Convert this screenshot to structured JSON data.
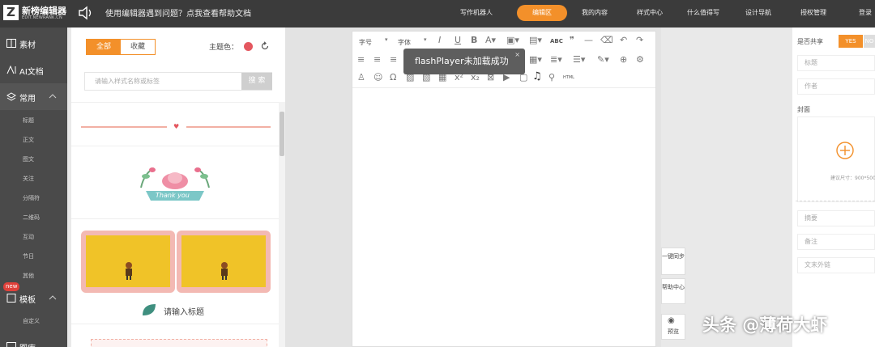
{
  "topbar": {
    "logo_mark": "Z",
    "logo_name": "新榜编辑器",
    "logo_sub": "EDIT.NEWRANK.CN",
    "notice": "使用编辑器遇到问题？点我查看帮助文档",
    "nav": [
      "写作机器人",
      "编辑区",
      "我的内容",
      "样式中心",
      "什么值得写",
      "设计导航",
      "授权管理",
      "登录"
    ],
    "active_color": "#f3902a"
  },
  "leftnav": {
    "main": [
      {
        "label": "素材",
        "icon": "material-icon"
      },
      {
        "label": "AI文档",
        "icon": "ai-doc-icon"
      },
      {
        "label": "常用",
        "icon": "layers-icon"
      },
      {
        "label": "模板",
        "icon": "template-icon"
      },
      {
        "label": "图库",
        "icon": "image-icon"
      }
    ],
    "sub_common": [
      "标题",
      "正文",
      "图文",
      "关注",
      "分隔符",
      "二维码",
      "互动",
      "节日",
      "其他"
    ],
    "sub_template": [
      "自定义"
    ],
    "new_badge": "new"
  },
  "panel": {
    "tab_all": "全部",
    "tab_fav": "收藏",
    "theme_label": "主题色：",
    "theme_color": "#e4575f",
    "search_placeholder": "请输入样式名称或标签",
    "search_button": "搜 索",
    "thank_you": "Thank you",
    "input_title": "请输入标题"
  },
  "editor": {
    "font_size": "字号",
    "font_family": "字体",
    "abc": "ABC",
    "html": "HTML",
    "toast": "flashPlayer未加载成功",
    "toast_close": "×"
  },
  "side_buttons": [
    "一键同步",
    "帮助中心",
    "预览"
  ],
  "right": {
    "share_label": "是否共享",
    "yes": "YES",
    "no": "NO",
    "title_ph": "标题",
    "author_ph": "作者",
    "cover_label": "封面",
    "cover_hint": "建议尺寸：900*500",
    "summary_ph": "摘要",
    "note_ph": "备注",
    "link_ph": "文末外链"
  },
  "watermark": "头条 @薄荷大虾"
}
